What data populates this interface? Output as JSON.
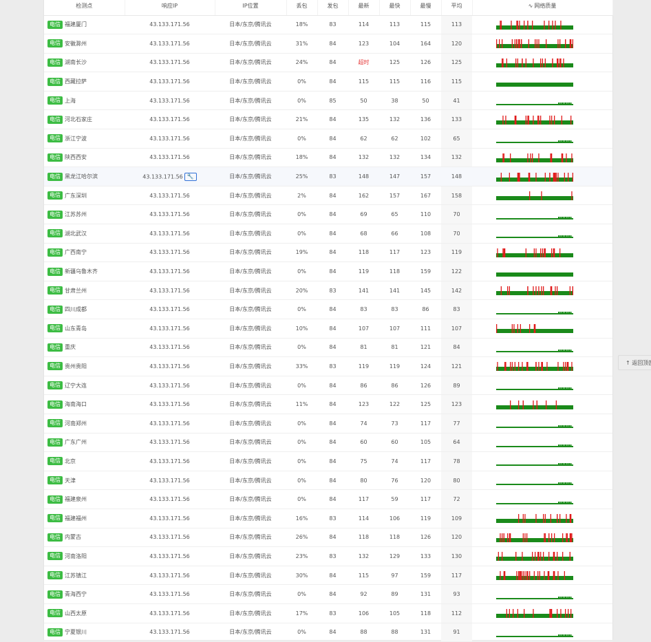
{
  "header": {
    "node": "检测点",
    "ip": "响应IP",
    "location": "IP位置",
    "loss": "丢包",
    "sent": "发包",
    "latest": "最新",
    "fastest": "最快",
    "slowest": "最慢",
    "avg": "平均",
    "quality": "网络质量",
    "quality_icon": "pulse-icon"
  },
  "colors": {
    "good": "#1a8a1a",
    "bad": "#e01b1b",
    "isp_badge": "#3cbc43"
  },
  "back_top": "↑ 返回顶部",
  "rows": [
    {
      "isp": "电信",
      "loc": "福建厦门",
      "ip": "43.133.171.56",
      "geo": "日本/东京/腾讯云",
      "loss": "18%",
      "sent": "83",
      "latest": "114",
      "fast": "113",
      "slow": "115",
      "avg": "113",
      "q": {
        "mode": "solid",
        "frac": 0.18
      }
    },
    {
      "isp": "电信",
      "loc": "安徽滁州",
      "ip": "43.133.171.56",
      "geo": "日本/东京/腾讯云",
      "loss": "31%",
      "sent": "84",
      "latest": "123",
      "fast": "104",
      "slow": "164",
      "avg": "120",
      "q": {
        "mode": "solid",
        "frac": 0.31
      }
    },
    {
      "isp": "电信",
      "loc": "湖南长沙",
      "ip": "43.133.171.56",
      "geo": "日本/东京/腾讯云",
      "loss": "24%",
      "sent": "84",
      "latest": "超时",
      "fast": "125",
      "slow": "126",
      "avg": "125",
      "q": {
        "mode": "solid",
        "frac": 0.24
      }
    },
    {
      "isp": "电信",
      "loc": "西藏拉萨",
      "ip": "43.133.171.56",
      "geo": "日本/东京/腾讯云",
      "loss": "0%",
      "sent": "84",
      "latest": "115",
      "fast": "115",
      "slow": "116",
      "avg": "115",
      "q": {
        "mode": "solid",
        "frac": 0
      }
    },
    {
      "isp": "电信",
      "loc": "上海",
      "ip": "43.133.171.56",
      "geo": "日本/东京/腾讯云",
      "loss": "0%",
      "sent": "85",
      "latest": "50",
      "fast": "38",
      "slow": "50",
      "avg": "41",
      "q": {
        "mode": "flat",
        "frac": 0
      }
    },
    {
      "isp": "电信",
      "loc": "河北石家庄",
      "ip": "43.133.171.56",
      "geo": "日本/东京/腾讯云",
      "loss": "21%",
      "sent": "84",
      "latest": "135",
      "fast": "132",
      "slow": "136",
      "avg": "133",
      "q": {
        "mode": "solid",
        "frac": 0.21
      }
    },
    {
      "isp": "电信",
      "loc": "浙江宁波",
      "ip": "43.133.171.56",
      "geo": "日本/东京/腾讯云",
      "loss": "0%",
      "sent": "84",
      "latest": "62",
      "fast": "62",
      "slow": "102",
      "avg": "65",
      "q": {
        "mode": "flat",
        "frac": 0
      }
    },
    {
      "isp": "电信",
      "loc": "陕西西安",
      "ip": "43.133.171.56",
      "geo": "日本/东京/腾讯云",
      "loss": "18%",
      "sent": "84",
      "latest": "132",
      "fast": "132",
      "slow": "134",
      "avg": "132",
      "q": {
        "mode": "solid",
        "frac": 0.18
      }
    },
    {
      "isp": "电信",
      "loc": "黑龙江哈尔滨",
      "ip": "43.133.171.56",
      "geo": "日本/东京/腾讯云",
      "loss": "25%",
      "sent": "83",
      "latest": "148",
      "fast": "147",
      "slow": "157",
      "avg": "148",
      "q": {
        "mode": "solid",
        "frac": 0.25
      },
      "highlight": true,
      "tool": true
    },
    {
      "isp": "电信",
      "loc": "广东深圳",
      "ip": "43.133.171.56",
      "geo": "日本/东京/腾讯云",
      "loss": "2%",
      "sent": "84",
      "latest": "162",
      "fast": "157",
      "slow": "167",
      "avg": "158",
      "q": {
        "mode": "solid",
        "frac": 0.03
      }
    },
    {
      "isp": "电信",
      "loc": "江苏苏州",
      "ip": "43.133.171.56",
      "geo": "日本/东京/腾讯云",
      "loss": "0%",
      "sent": "84",
      "latest": "69",
      "fast": "65",
      "slow": "110",
      "avg": "70",
      "q": {
        "mode": "flat",
        "frac": 0
      }
    },
    {
      "isp": "电信",
      "loc": "湖北武汉",
      "ip": "43.133.171.56",
      "geo": "日本/东京/腾讯云",
      "loss": "0%",
      "sent": "84",
      "latest": "68",
      "fast": "66",
      "slow": "108",
      "avg": "70",
      "q": {
        "mode": "flat",
        "frac": 0
      }
    },
    {
      "isp": "电信",
      "loc": "广西南宁",
      "ip": "43.133.171.56",
      "geo": "日本/东京/腾讯云",
      "loss": "19%",
      "sent": "84",
      "latest": "118",
      "fast": "117",
      "slow": "123",
      "avg": "119",
      "q": {
        "mode": "solid",
        "frac": 0.19
      }
    },
    {
      "isp": "电信",
      "loc": "新疆乌鲁木齐",
      "ip": "43.133.171.56",
      "geo": "日本/东京/腾讯云",
      "loss": "0%",
      "sent": "84",
      "latest": "119",
      "fast": "118",
      "slow": "159",
      "avg": "122",
      "q": {
        "mode": "solid",
        "frac": 0
      }
    },
    {
      "isp": "电信",
      "loc": "甘肃兰州",
      "ip": "43.133.171.56",
      "geo": "日本/东京/腾讯云",
      "loss": "20%",
      "sent": "83",
      "latest": "141",
      "fast": "141",
      "slow": "145",
      "avg": "142",
      "q": {
        "mode": "solid",
        "frac": 0.2
      }
    },
    {
      "isp": "电信",
      "loc": "四川成都",
      "ip": "43.133.171.56",
      "geo": "日本/东京/腾讯云",
      "loss": "0%",
      "sent": "84",
      "latest": "83",
      "fast": "83",
      "slow": "86",
      "avg": "83",
      "q": {
        "mode": "flat",
        "frac": 0
      }
    },
    {
      "isp": "电信",
      "loc": "山东青岛",
      "ip": "43.133.171.56",
      "geo": "日本/东京/腾讯云",
      "loss": "10%",
      "sent": "84",
      "latest": "107",
      "fast": "107",
      "slow": "111",
      "avg": "107",
      "q": {
        "mode": "solid",
        "frac": 0.1
      }
    },
    {
      "isp": "电信",
      "loc": "重庆",
      "ip": "43.133.171.56",
      "geo": "日本/东京/腾讯云",
      "loss": "0%",
      "sent": "84",
      "latest": "81",
      "fast": "81",
      "slow": "121",
      "avg": "84",
      "q": {
        "mode": "flat",
        "frac": 0
      }
    },
    {
      "isp": "电信",
      "loc": "贵州贵阳",
      "ip": "43.133.171.56",
      "geo": "日本/东京/腾讯云",
      "loss": "33%",
      "sent": "83",
      "latest": "119",
      "fast": "119",
      "slow": "124",
      "avg": "121",
      "q": {
        "mode": "solid",
        "frac": 0.33
      }
    },
    {
      "isp": "电信",
      "loc": "辽宁大连",
      "ip": "43.133.171.56",
      "geo": "日本/东京/腾讯云",
      "loss": "0%",
      "sent": "84",
      "latest": "86",
      "fast": "86",
      "slow": "126",
      "avg": "89",
      "q": {
        "mode": "flat",
        "frac": 0
      }
    },
    {
      "isp": "电信",
      "loc": "海南海口",
      "ip": "43.133.171.56",
      "geo": "日本/东京/腾讯云",
      "loss": "11%",
      "sent": "84",
      "latest": "123",
      "fast": "122",
      "slow": "125",
      "avg": "123",
      "q": {
        "mode": "solid",
        "frac": 0.11
      }
    },
    {
      "isp": "电信",
      "loc": "河南郑州",
      "ip": "43.133.171.56",
      "geo": "日本/东京/腾讯云",
      "loss": "0%",
      "sent": "84",
      "latest": "74",
      "fast": "73",
      "slow": "117",
      "avg": "77",
      "q": {
        "mode": "flat",
        "frac": 0
      }
    },
    {
      "isp": "电信",
      "loc": "广东广州",
      "ip": "43.133.171.56",
      "geo": "日本/东京/腾讯云",
      "loss": "0%",
      "sent": "84",
      "latest": "60",
      "fast": "60",
      "slow": "105",
      "avg": "64",
      "q": {
        "mode": "flat",
        "frac": 0
      }
    },
    {
      "isp": "电信",
      "loc": "北京",
      "ip": "43.133.171.56",
      "geo": "日本/东京/腾讯云",
      "loss": "0%",
      "sent": "84",
      "latest": "75",
      "fast": "74",
      "slow": "117",
      "avg": "78",
      "q": {
        "mode": "flat",
        "frac": 0
      }
    },
    {
      "isp": "电信",
      "loc": "天津",
      "ip": "43.133.171.56",
      "geo": "日本/东京/腾讯云",
      "loss": "0%",
      "sent": "84",
      "latest": "80",
      "fast": "76",
      "slow": "120",
      "avg": "80",
      "q": {
        "mode": "flat",
        "frac": 0
      }
    },
    {
      "isp": "电信",
      "loc": "福建泉州",
      "ip": "43.133.171.56",
      "geo": "日本/东京/腾讯云",
      "loss": "0%",
      "sent": "84",
      "latest": "117",
      "fast": "59",
      "slow": "117",
      "avg": "72",
      "q": {
        "mode": "flat",
        "frac": 0
      }
    },
    {
      "isp": "电信",
      "loc": "福建福州",
      "ip": "43.133.171.56",
      "geo": "日本/东京/腾讯云",
      "loss": "16%",
      "sent": "83",
      "latest": "114",
      "fast": "106",
      "slow": "119",
      "avg": "109",
      "q": {
        "mode": "solid",
        "frac": 0.16
      }
    },
    {
      "isp": "电信",
      "loc": "内蒙古",
      "ip": "43.133.171.56",
      "geo": "日本/东京/腾讯云",
      "loss": "26%",
      "sent": "84",
      "latest": "118",
      "fast": "118",
      "slow": "126",
      "avg": "120",
      "q": {
        "mode": "solid",
        "frac": 0.26
      }
    },
    {
      "isp": "电信",
      "loc": "河南洛阳",
      "ip": "43.133.171.56",
      "geo": "日本/东京/腾讯云",
      "loss": "23%",
      "sent": "83",
      "latest": "132",
      "fast": "129",
      "slow": "133",
      "avg": "130",
      "q": {
        "mode": "solid",
        "frac": 0.23
      }
    },
    {
      "isp": "电信",
      "loc": "江苏镇江",
      "ip": "43.133.171.56",
      "geo": "日本/东京/腾讯云",
      "loss": "30%",
      "sent": "84",
      "latest": "115",
      "fast": "97",
      "slow": "159",
      "avg": "117",
      "q": {
        "mode": "solid",
        "frac": 0.3
      }
    },
    {
      "isp": "电信",
      "loc": "青海西宁",
      "ip": "43.133.171.56",
      "geo": "日本/东京/腾讯云",
      "loss": "0%",
      "sent": "84",
      "latest": "92",
      "fast": "89",
      "slow": "131",
      "avg": "93",
      "q": {
        "mode": "flat",
        "frac": 0
      }
    },
    {
      "isp": "电信",
      "loc": "山西太原",
      "ip": "43.133.171.56",
      "geo": "日本/东京/腾讯云",
      "loss": "17%",
      "sent": "83",
      "latest": "106",
      "fast": "105",
      "slow": "118",
      "avg": "112",
      "q": {
        "mode": "solid",
        "frac": 0.17
      }
    },
    {
      "isp": "电信",
      "loc": "宁夏银川",
      "ip": "43.133.171.56",
      "geo": "日本/东京/腾讯云",
      "loss": "0%",
      "sent": "84",
      "latest": "88",
      "fast": "88",
      "slow": "131",
      "avg": "91",
      "q": {
        "mode": "flat",
        "frac": 0
      }
    }
  ]
}
